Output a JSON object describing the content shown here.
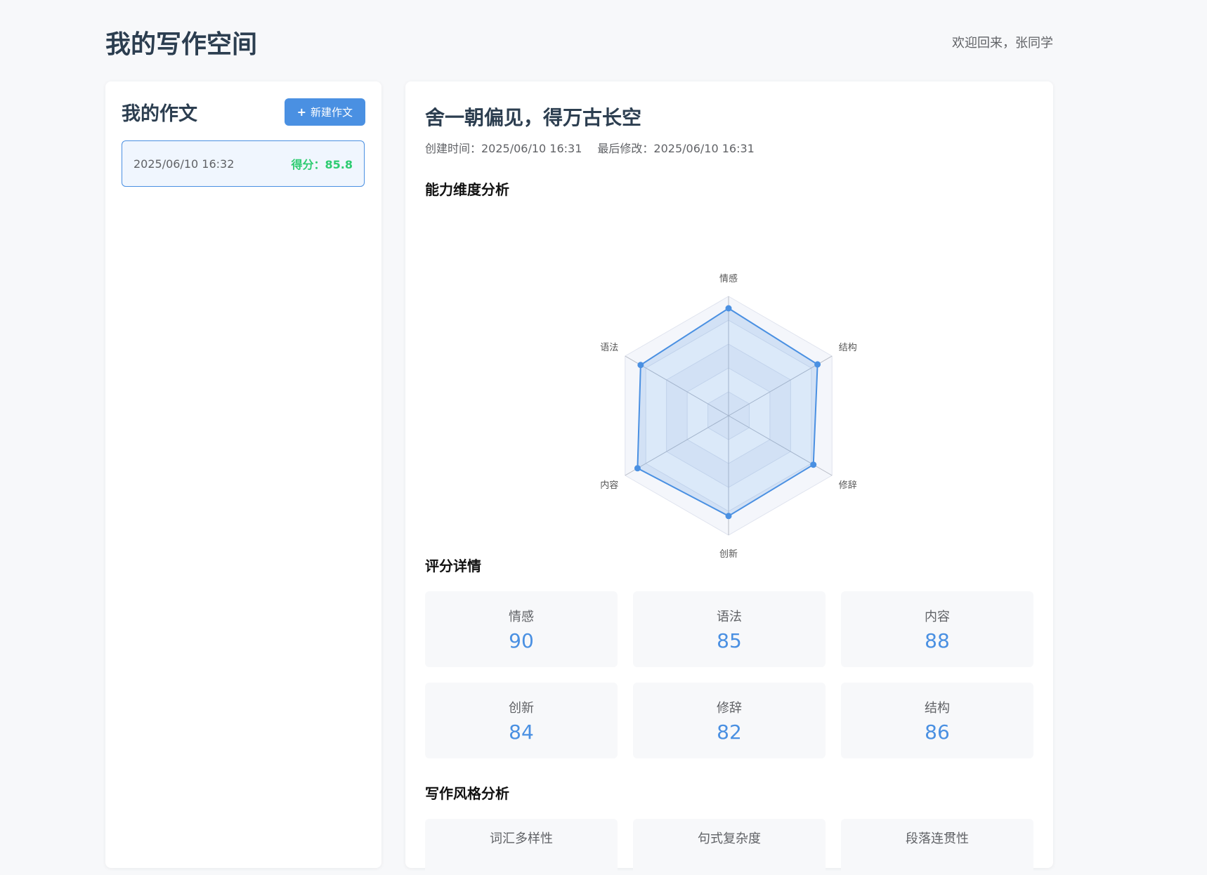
{
  "header": {
    "title": "我的写作空间",
    "welcome": "欢迎回来，张同学"
  },
  "sidebar": {
    "title": "我的作文",
    "new_button_label": "新建作文",
    "essays": [
      {
        "date": "2025/06/10 16:32",
        "score": "得分：85.8"
      }
    ]
  },
  "essay": {
    "title": "舍一朝偏见，得万古长空",
    "created": "创建时间：2025/06/10 16:31",
    "modified": "最后修改：2025/06/10 16:31"
  },
  "sections": {
    "radar_title": "能力维度分析",
    "scores_title": "评分详情",
    "style_title": "写作风格分析"
  },
  "chart_data": {
    "type": "radar",
    "axes": [
      "情感",
      "结构",
      "修辞",
      "创新",
      "内容",
      "语法"
    ],
    "values": [
      90,
      86,
      82,
      84,
      88,
      85
    ],
    "range": [
      0,
      100
    ],
    "rings": 5,
    "color": "#4a90e2"
  },
  "scores": [
    {
      "label": "情感",
      "value": "90"
    },
    {
      "label": "语法",
      "value": "85"
    },
    {
      "label": "内容",
      "value": "88"
    },
    {
      "label": "创新",
      "value": "84"
    },
    {
      "label": "修辞",
      "value": "82"
    },
    {
      "label": "结构",
      "value": "86"
    }
  ],
  "style_metrics": [
    {
      "label": "词汇多样性"
    },
    {
      "label": "句式复杂度"
    },
    {
      "label": "段落连贯性"
    }
  ],
  "colors": {
    "accent": "#4a90e2",
    "score_green": "#2ecc71",
    "background": "#f7f8fa"
  }
}
